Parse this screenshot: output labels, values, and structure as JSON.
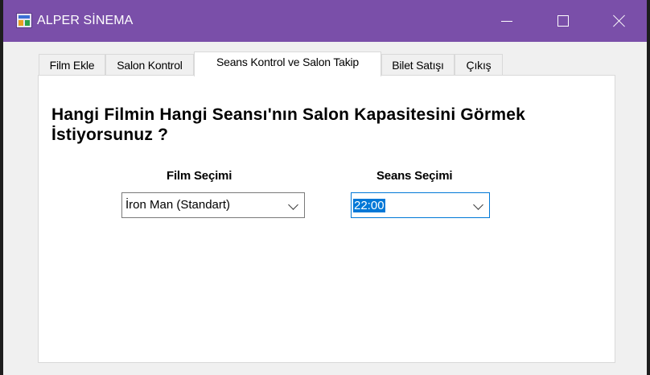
{
  "window": {
    "title": "ALPER SİNEMA",
    "controls": {
      "minimize": "minimize-icon",
      "maximize": "maximize-icon",
      "close": "close-icon"
    },
    "titlebar_color": "#7a4fa9"
  },
  "tabs": [
    {
      "label": "Film Ekle"
    },
    {
      "label": "Salon Kontrol"
    },
    {
      "label": "Seans Kontrol ve Salon Takip"
    },
    {
      "label": "Bilet Satışı"
    },
    {
      "label": "Çıkış"
    }
  ],
  "active_tab": "Seans Kontrol ve Salon Takip",
  "panel": {
    "question": "Hangi Filmin Hangi Seansı'nın Salon Kapasitesini Görmek İstiyorsunuz ?",
    "film": {
      "label": "Film Seçimi",
      "selected": "İron Man (Standart)"
    },
    "seans": {
      "label": "Seans Seçimi",
      "selected": "22:00"
    }
  },
  "colors": {
    "selection": "#0078d7"
  }
}
